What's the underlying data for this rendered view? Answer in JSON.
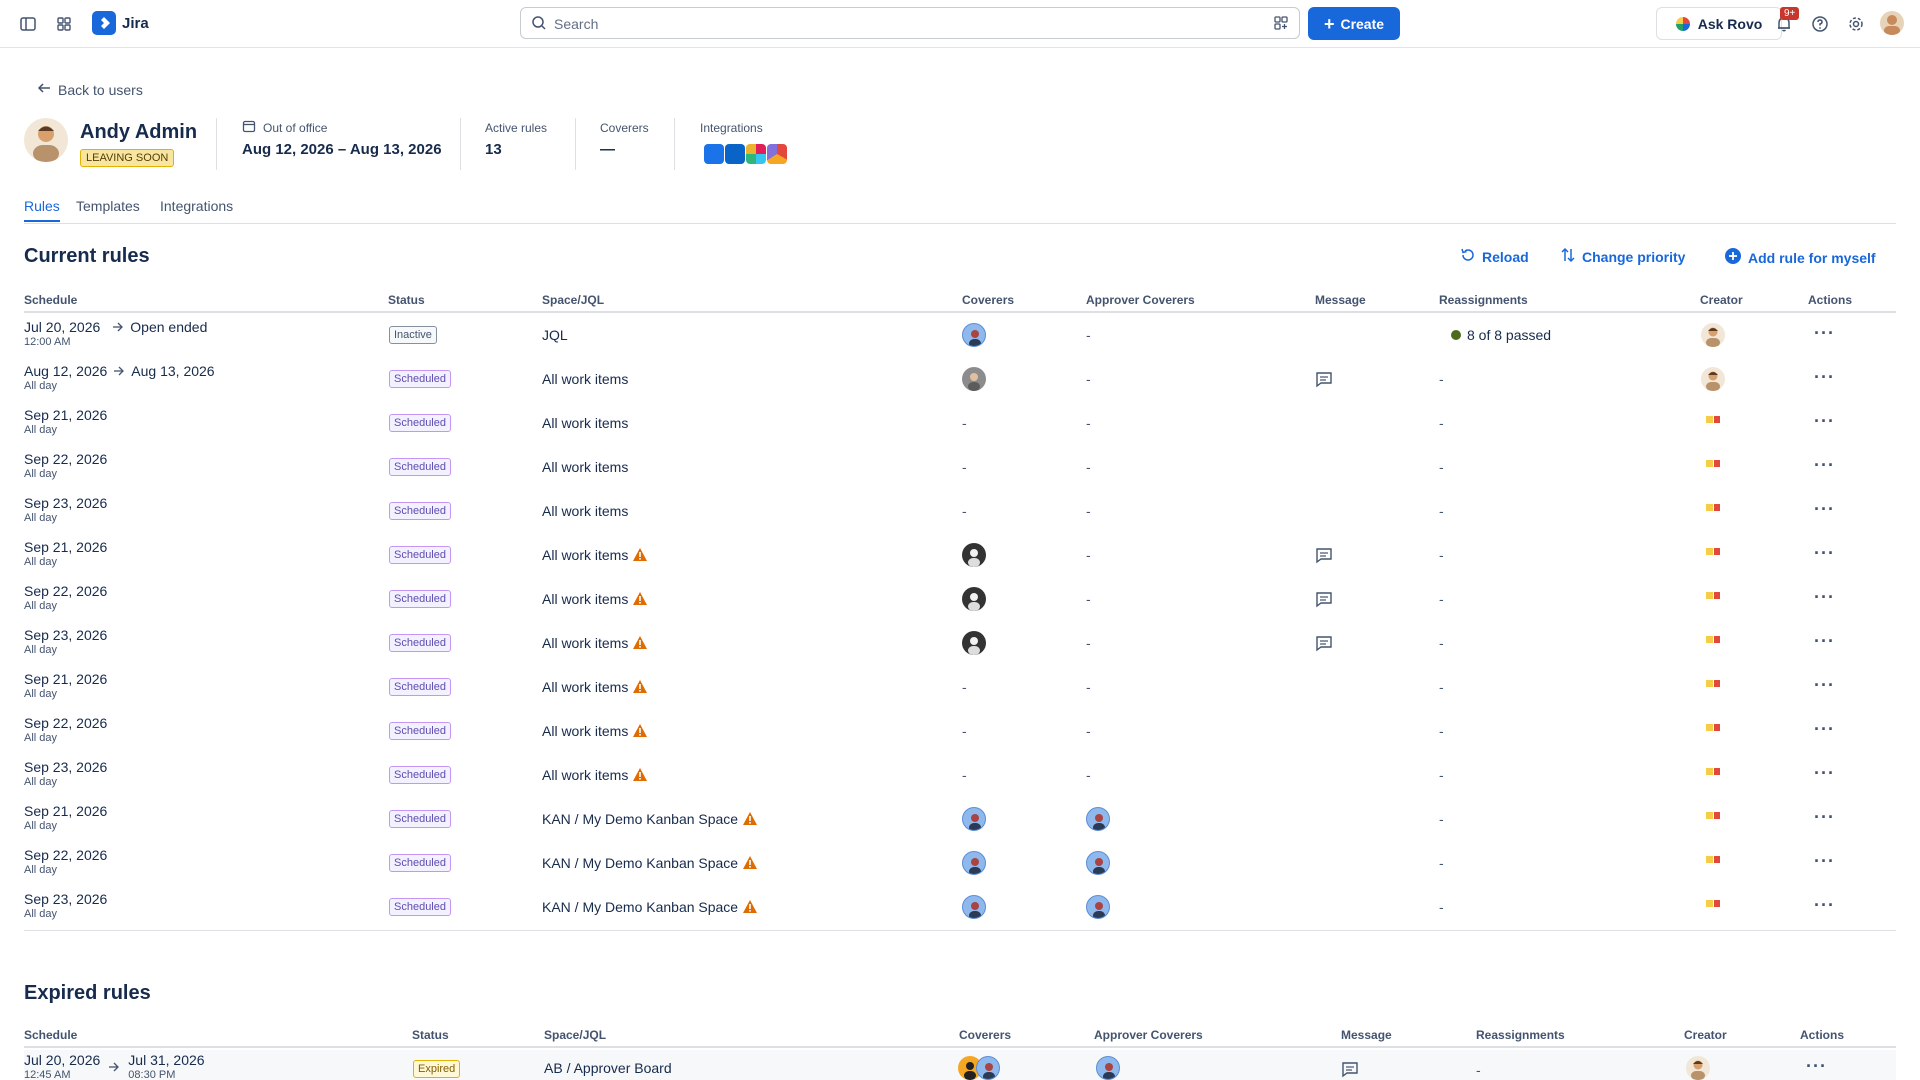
{
  "topbar": {
    "app_name": "Jira",
    "search_placeholder": "Search",
    "create_label": "Create",
    "rovo_label": "Ask Rovo",
    "notification_badge": "9+"
  },
  "header": {
    "back_label": "Back to users",
    "user_name": "Andy Admin",
    "user_badge": "LEAVING SOON",
    "ooo_label": "Out of office",
    "ooo_value": "Aug 12, 2026 – Aug 13, 2026",
    "active_rules_label": "Active rules",
    "active_rules_value": "13",
    "coverers_label": "Coverers",
    "coverers_value": "—",
    "integrations_label": "Integrations"
  },
  "tabs": [
    "Rules",
    "Templates",
    "Integrations"
  ],
  "current": {
    "title": "Current rules",
    "actions": {
      "reload": "Reload",
      "priority": "Change priority",
      "add": "Add rule for myself"
    },
    "columns": [
      "Schedule",
      "Status",
      "Space/JQL",
      "Coverers",
      "Approver Coverers",
      "Message",
      "Reassignments",
      "Creator",
      "Actions"
    ],
    "rows": [
      {
        "date": "Jul 20, 2026",
        "end": "Open ended",
        "sub": "12:00 AM",
        "status": "Inactive",
        "space": "JQL",
        "warn": false,
        "coverer": "blue",
        "approver": "-",
        "message": false,
        "reassign": "8 of 8 passed",
        "creator": "photo"
      },
      {
        "date": "Aug 12, 2026",
        "end": "Aug 13, 2026",
        "sub": "All day",
        "status": "Scheduled",
        "space": "All work items",
        "warn": false,
        "coverer": "grey",
        "approver": "-",
        "message": true,
        "reassign": "-",
        "creator": "photo"
      },
      {
        "date": "Sep 21, 2026",
        "end": "",
        "sub": "All day",
        "status": "Scheduled",
        "space": "All work items",
        "warn": false,
        "coverer": "-",
        "approver": "-",
        "message": false,
        "reassign": "-",
        "creator": "mini"
      },
      {
        "date": "Sep 22, 2026",
        "end": "",
        "sub": "All day",
        "status": "Scheduled",
        "space": "All work items",
        "warn": false,
        "coverer": "-",
        "approver": "-",
        "message": false,
        "reassign": "-",
        "creator": "mini"
      },
      {
        "date": "Sep 23, 2026",
        "end": "",
        "sub": "All day",
        "status": "Scheduled",
        "space": "All work items",
        "warn": false,
        "coverer": "-",
        "approver": "-",
        "message": false,
        "reassign": "-",
        "creator": "mini"
      },
      {
        "date": "Sep 21, 2026",
        "end": "",
        "sub": "All day",
        "status": "Scheduled",
        "space": "All work items",
        "warn": true,
        "coverer": "bw",
        "approver": "-",
        "message": true,
        "reassign": "-",
        "creator": "mini"
      },
      {
        "date": "Sep 22, 2026",
        "end": "",
        "sub": "All day",
        "status": "Scheduled",
        "space": "All work items",
        "warn": true,
        "coverer": "bw",
        "approver": "-",
        "message": true,
        "reassign": "-",
        "creator": "mini"
      },
      {
        "date": "Sep 23, 2026",
        "end": "",
        "sub": "All day",
        "status": "Scheduled",
        "space": "All work items",
        "warn": true,
        "coverer": "bw",
        "approver": "-",
        "message": true,
        "reassign": "-",
        "creator": "mini"
      },
      {
        "date": "Sep 21, 2026",
        "end": "",
        "sub": "All day",
        "status": "Scheduled",
        "space": "All work items",
        "warn": true,
        "coverer": "-",
        "approver": "-",
        "message": false,
        "reassign": "-",
        "creator": "mini"
      },
      {
        "date": "Sep 22, 2026",
        "end": "",
        "sub": "All day",
        "status": "Scheduled",
        "space": "All work items",
        "warn": true,
        "coverer": "-",
        "approver": "-",
        "message": false,
        "reassign": "-",
        "creator": "mini"
      },
      {
        "date": "Sep 23, 2026",
        "end": "",
        "sub": "All day",
        "status": "Scheduled",
        "space": "All work items",
        "warn": true,
        "coverer": "-",
        "approver": "-",
        "message": false,
        "reassign": "-",
        "creator": "mini"
      },
      {
        "date": "Sep 21, 2026",
        "end": "",
        "sub": "All day",
        "status": "Scheduled",
        "space": "KAN / My Demo Kanban Space",
        "warn": true,
        "coverer": "blue",
        "approver": "blue",
        "message": false,
        "reassign": "-",
        "creator": "mini"
      },
      {
        "date": "Sep 22, 2026",
        "end": "",
        "sub": "All day",
        "status": "Scheduled",
        "space": "KAN / My Demo Kanban Space",
        "warn": true,
        "coverer": "blue",
        "approver": "blue",
        "message": false,
        "reassign": "-",
        "creator": "mini"
      },
      {
        "date": "Sep 23, 2026",
        "end": "",
        "sub": "All day",
        "status": "Scheduled",
        "space": "KAN / My Demo Kanban Space",
        "warn": true,
        "coverer": "blue",
        "approver": "blue",
        "message": false,
        "reassign": "-",
        "creator": "mini"
      }
    ]
  },
  "expired": {
    "title": "Expired rules",
    "columns": [
      "Schedule",
      "Status",
      "Space/JQL",
      "Coverers",
      "Approver Coverers",
      "Message",
      "Reassignments",
      "Creator",
      "Actions"
    ],
    "row": {
      "date": "Jul 20, 2026",
      "end": "Jul 31, 2026",
      "sub": "12:45 AM",
      "end_sub": "08:30 PM",
      "status": "Expired",
      "space": "AB / Approver Board",
      "reassign": "-"
    }
  },
  "colors": {
    "accent": "#1868db",
    "scheduled": "#5e4db2",
    "warning": "#e06c00"
  }
}
